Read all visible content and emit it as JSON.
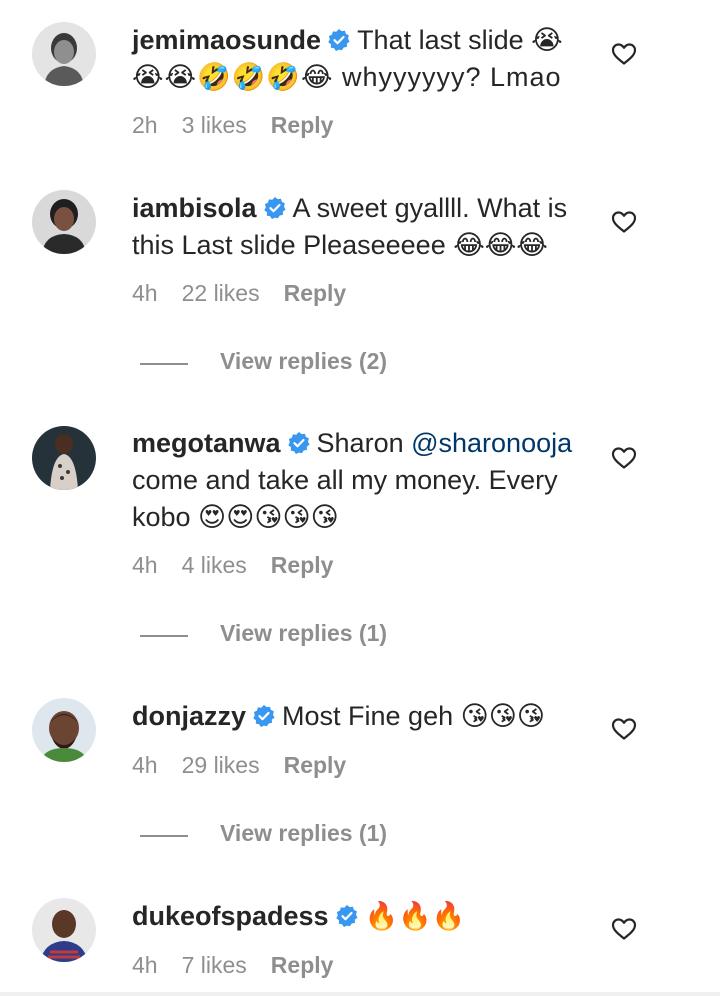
{
  "comments": [
    {
      "username": "jemimaosunde",
      "text": "That last slide 😭",
      "text2": "😭😭🤣🤣🤣😂 whyyyyyy? Lmao",
      "time": "2h",
      "likes": "3 likes",
      "reply": "Reply"
    },
    {
      "username": "iambisola",
      "text": "A sweet gyallll. What is this Last slide Pleaseeeee 😂😂😂",
      "time": "4h",
      "likes": "22 likes",
      "reply": "Reply",
      "view_replies": "View replies (2)"
    },
    {
      "username": "megotanwa",
      "text_before": "Sharon ",
      "mention": "@sharonooja",
      "text_after": " come and take all my money. Every kobo 😍😍😘😘😘",
      "time": "4h",
      "likes": "4 likes",
      "reply": "Reply",
      "view_replies": "View replies (1)"
    },
    {
      "username": "donjazzy",
      "text": "Most Fine geh 😘😘😘",
      "time": "4h",
      "likes": "29 likes",
      "reply": "Reply",
      "view_replies": "View replies (1)"
    },
    {
      "username": "dukeofspadess",
      "text": "🔥🔥🔥",
      "time": "4h",
      "likes": "7 likes",
      "reply": "Reply"
    }
  ],
  "icons": {
    "verified": "verified-badge-icon",
    "like": "heart-outline-icon"
  },
  "colors": {
    "verified": "#3897f0",
    "mention": "#00376b",
    "muted": "#8e8e8e",
    "text": "#262626"
  }
}
